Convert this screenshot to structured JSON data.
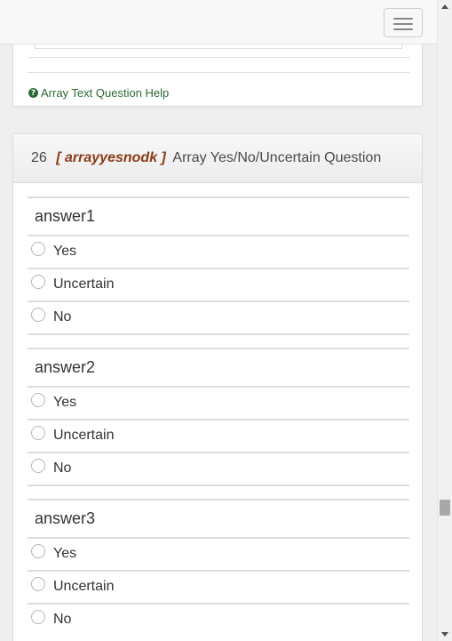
{
  "help": {
    "icon": "question-circle-icon",
    "text": "Array Text Question Help"
  },
  "question": {
    "number": "26",
    "code": "[ arrayyesnodk ]",
    "text": "Array Yes/No/Uncertain Question"
  },
  "subquestions": [
    {
      "label": "answer1",
      "options": [
        "Yes",
        "Uncertain",
        "No"
      ]
    },
    {
      "label": "answer2",
      "options": [
        "Yes",
        "Uncertain",
        "No"
      ]
    },
    {
      "label": "answer3",
      "options": [
        "Yes",
        "Uncertain",
        "No"
      ]
    }
  ]
}
